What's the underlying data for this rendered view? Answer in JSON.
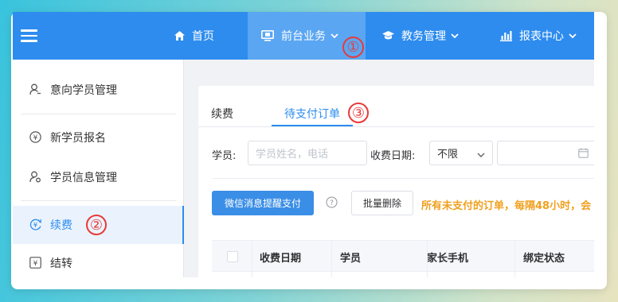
{
  "topnav": {
    "items": [
      {
        "label": "首页",
        "icon": "home-icon"
      },
      {
        "label": "前台业务",
        "icon": "monitor-icon",
        "active": true
      },
      {
        "label": "教务管理",
        "icon": "graduation-cap-icon"
      },
      {
        "label": "报表中心",
        "icon": "bar-chart-icon"
      }
    ],
    "color": "#2e8cef"
  },
  "sidebar": {
    "items": [
      {
        "label": "意向学员管理",
        "icon": "user-icon"
      },
      {
        "label": "新学员报名",
        "icon": "yen-coin-icon"
      },
      {
        "label": "学员信息管理",
        "icon": "user-settings-icon"
      },
      {
        "label": "续费",
        "icon": "yen-refresh-icon",
        "active": true
      },
      {
        "label": "结转",
        "icon": "yen-transfer-icon"
      }
    ]
  },
  "tabs": [
    {
      "label": "续费"
    },
    {
      "label": "待支付订单",
      "active": true
    }
  ],
  "filters": {
    "student_label": "学员:",
    "student_placeholder": "学员姓名，电话",
    "date_label": "收费日期:",
    "date_select": "不限"
  },
  "actions": {
    "wechat_reminder": "微信消息提醒支付",
    "batch_delete": "批量删除",
    "help_icon": "question-circle-icon",
    "notice": "所有未支付的订单，每隔48小时，会"
  },
  "table": {
    "columns": [
      "收费日期",
      "学员",
      "家长手机",
      "绑定状态"
    ]
  },
  "annotations": [
    "①",
    "②",
    "③"
  ]
}
